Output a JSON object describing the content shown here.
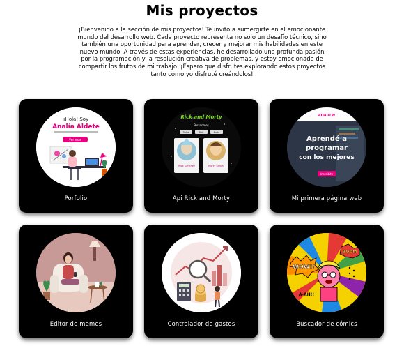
{
  "page": {
    "title": "Mis proyectos",
    "intro": "¡Bienvenido a la sección de mis proyectos! Te invito a sumergirte en el emocionante mundo del desarrollo web. Cada proyecto representa no solo un desafío técnico, sino también una oportunidad para aprender, crecer y mejorar mis habilidades en este nuevo mundo. A través de estas experiencias, he desarrollado una profunda pasión por la programación y la resolución creativa de problemas, y estoy emocionada de compartir los frutos de mi trabajo. ¡Espero que disfrutes explorando estos proyectos tanto como yo disfruté creándolos!"
  },
  "projects": [
    {
      "label": "Porfolio",
      "icon": "portfolio-thumbnail",
      "thumb": {
        "greeting": "¡Hola! Soy",
        "name": "Analía Aldete",
        "button": "Ver más"
      }
    },
    {
      "label": "Api Rick and Morty",
      "icon": "rick-and-morty-thumbnail",
      "thumb": {
        "logo": "Rick and Morty",
        "subtitle": "Personajes",
        "filters": [
          "Todos",
          "Rick",
          "Morty"
        ],
        "cards": [
          "Rick Sanchez",
          "Morty Smith"
        ]
      }
    },
    {
      "label": "Mi primera página web",
      "icon": "first-webpage-thumbnail",
      "thumb": {
        "brand": "ADA ITW",
        "headline_1": "Aprendé a",
        "headline_2": "programar",
        "headline_3": "con los mejores",
        "button": "Inscribite"
      }
    },
    {
      "label": "Editor de memes",
      "icon": "meme-editor-thumbnail"
    },
    {
      "label": "Controlador de gastos",
      "icon": "expense-tracker-thumbnail"
    },
    {
      "label": "Buscador de cómics",
      "icon": "comic-search-thumbnail",
      "thumb": {
        "word_1": "WOW!!",
        "word_2": "BOOM",
        "word_3": "A-AH!!"
      }
    }
  ],
  "colors": {
    "card_bg": "#000000",
    "accent_pink": "#e6007e",
    "portfolio_bg": "#ffffff",
    "meme_bg": "#b98a8a",
    "comic_bg": "#f5d100"
  }
}
